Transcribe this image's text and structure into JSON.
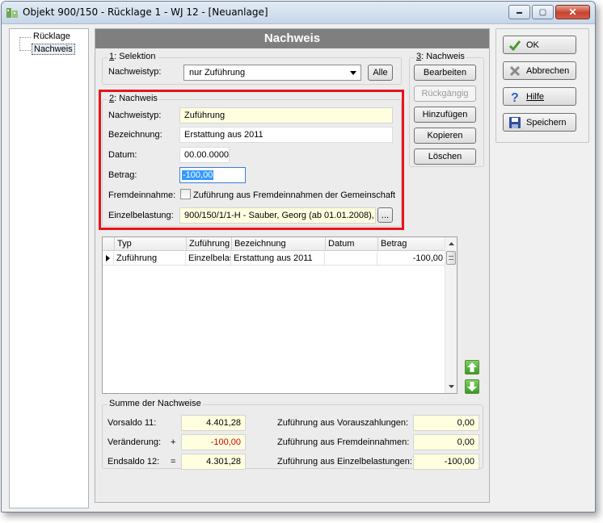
{
  "window": {
    "title": "Objekt 900/150 - Rücklage 1 - WJ 12 - [Neuanlage]",
    "controls": {
      "minimize": "▬",
      "maximize": "▢",
      "close": "✕"
    }
  },
  "tree": {
    "items": [
      "Rücklage",
      "Nachweis"
    ],
    "selected": "Nachweis"
  },
  "panel": {
    "header": "Nachweis",
    "selektion": {
      "title_num": "1",
      "title_rest": ": Selektion",
      "nachweistyp_label": "Nachweistyp:",
      "nachweistyp_value": "nur Zuführung",
      "alle_button": "Alle"
    },
    "nachweis_actions": {
      "title_num": "3",
      "title_rest": ": Nachweis",
      "buttons": [
        "Bearbeiten",
        "Rückgängig",
        "Hinzufügen",
        "Kopieren",
        "Löschen"
      ]
    },
    "nachweis": {
      "title_num": "2",
      "title_rest": ": Nachweis",
      "fields": {
        "nachweistyp": {
          "label": "Nachweistyp:",
          "value": "Zuführung"
        },
        "bezeichnung": {
          "label": "Bezeichnung:",
          "value": "Erstattung aus 2011"
        },
        "datum": {
          "label": "Datum:",
          "value": "00.00.0000"
        },
        "betrag": {
          "label": "Betrag:",
          "value": "-100,00"
        },
        "fremdeinnahme": {
          "label": "Fremdeinnahme:",
          "checkbox_label": "Zuführung aus Fremdeinnahmen der Gemeinschaft",
          "checked": false
        },
        "einzelbelastung": {
          "label": "Einzelbelastung:",
          "value": "900/150/1/1-H - Sauber, Georg  (ab 01.01.2008),",
          "browse": "..."
        }
      }
    },
    "table": {
      "columns": [
        "Typ",
        "Zuführung",
        "Bezeichnung",
        "Datum",
        "Betrag"
      ],
      "rows": [
        {
          "typ": "Zuführung",
          "zufuehrung": "Einzelbelas",
          "bezeichnung": "Erstattung aus 2011",
          "datum": "",
          "betrag": "-100,00"
        }
      ]
    },
    "summe": {
      "title": "Summe der Nachweise",
      "vorsaldo": {
        "label": "Vorsaldo 11:",
        "sign": "",
        "value": "4.401,28"
      },
      "veraenderung": {
        "label": "Veränderung:",
        "sign": "+",
        "value": "-100,00"
      },
      "endsaldo": {
        "label": "Endsaldo 12:",
        "sign": "=",
        "value": "4.301,28"
      },
      "vorauszahlungen": {
        "label": "Zuführung aus Vorauszahlungen:",
        "value": "0,00"
      },
      "fremdeinnahmen": {
        "label": "Zuführung aus Fremdeinnahmen:",
        "value": "0,00"
      },
      "einzelbelastungen": {
        "label": "Zuführung aus Einzelbelastungen:",
        "value": "-100,00"
      }
    }
  },
  "side_buttons": {
    "ok": "OK",
    "abbrechen": "Abbrechen",
    "hilfe": "Hilfe",
    "speichern": "Speichern"
  },
  "colors": {
    "highlight_frame": "#e8141b",
    "panel_header": "#7f7f7f",
    "readonly_field": "#ffffe0",
    "negative_value": "#d00000"
  }
}
